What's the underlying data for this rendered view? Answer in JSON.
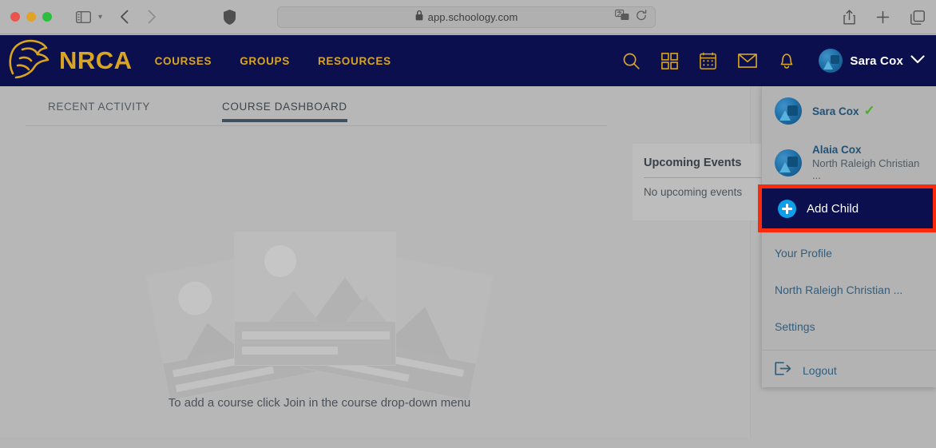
{
  "browser": {
    "url": "app.schoology.com",
    "lock_icon": "lock-icon",
    "shield_icon": "shield-icon",
    "back_icon": "chevron-left-icon",
    "forward_icon": "chevron-right-icon",
    "sidebar_icon": "sidebar-toggle-icon",
    "sidebar_chevron_icon": "chevron-down-icon",
    "translate_icon": "translate-icon",
    "reload_icon": "reload-icon",
    "share_icon": "share-icon",
    "newtab_icon": "plus-icon",
    "tabs_icon": "tab-overview-icon"
  },
  "topnav": {
    "brand": "NRCA",
    "logo_icon": "spartan-helmet-logo",
    "links": [
      {
        "label": "COURSES"
      },
      {
        "label": "GROUPS"
      },
      {
        "label": "RESOURCES"
      }
    ],
    "icons": [
      {
        "name": "search-icon"
      },
      {
        "name": "grid-apps-icon"
      },
      {
        "name": "calendar-icon"
      },
      {
        "name": "messages-envelope-icon"
      },
      {
        "name": "notifications-bell-icon"
      }
    ],
    "user_name": "Sara Cox",
    "user_chevron_icon": "chevron-down-icon",
    "avatar_icon": "user-avatar"
  },
  "main": {
    "tabs": [
      {
        "label": "RECENT ACTIVITY",
        "active": false
      },
      {
        "label": "COURSE DASHBOARD",
        "active": true
      }
    ],
    "empty_state_text": "To add a course click Join in the course drop-down menu",
    "events_card": {
      "title": "Upcoming Events",
      "empty": "No upcoming events"
    }
  },
  "dropdown": {
    "children": [
      {
        "name": "Sara Cox",
        "school": "",
        "checked": true,
        "check_icon": "checkmark-icon"
      },
      {
        "name": "Alaia Cox",
        "school": "North Raleigh Christian ...",
        "checked": false
      }
    ],
    "add_child": {
      "label": "Add Child",
      "plus_icon": "plus-circle-icon",
      "highlight_color": "#fc2a0d",
      "background_color": "#0b0f4d"
    },
    "links": [
      {
        "label": "Your Profile"
      },
      {
        "label": "North Raleigh Christian ..."
      },
      {
        "label": "Settings"
      }
    ],
    "logout": {
      "label": "Logout",
      "icon": "logout-arrow-icon"
    }
  }
}
